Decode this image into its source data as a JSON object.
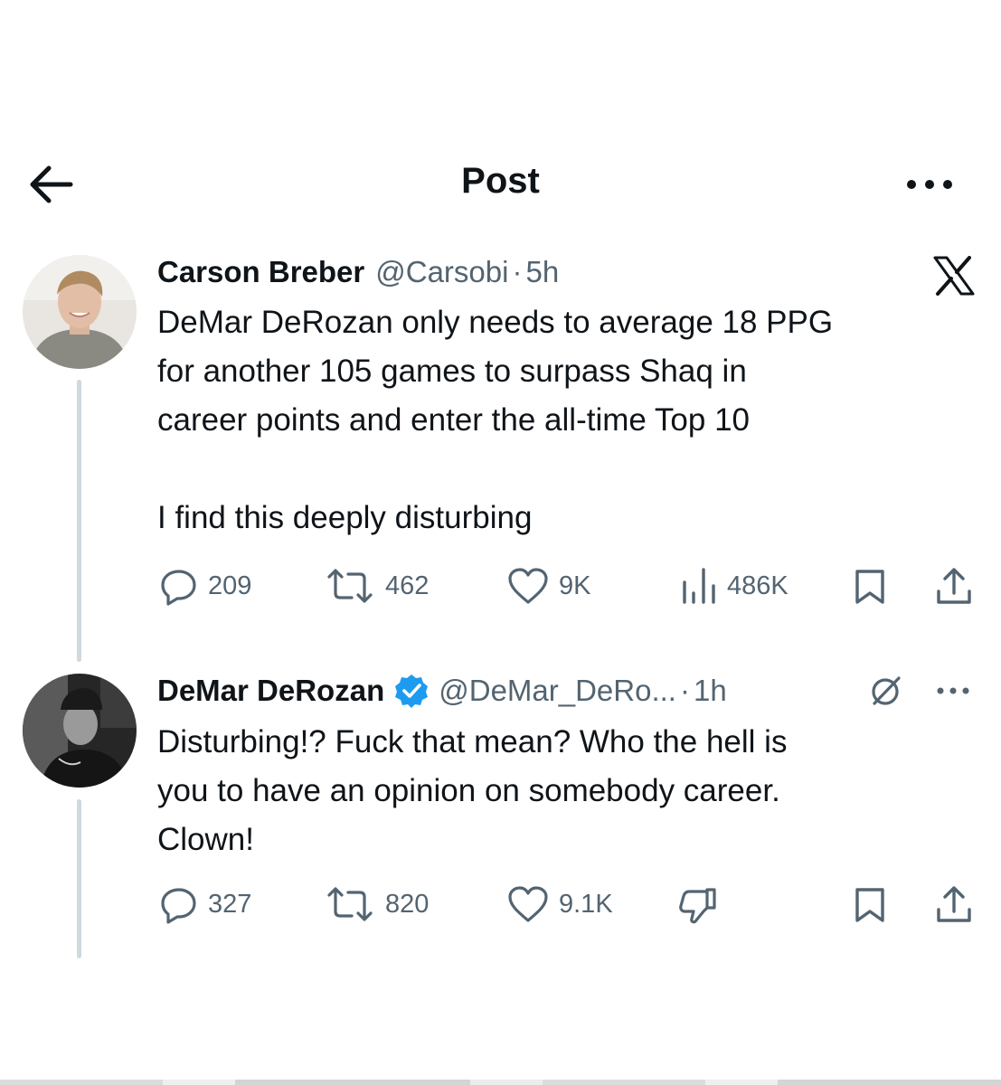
{
  "header": {
    "title": "Post",
    "back_icon": "arrow-left-icon",
    "more_icon": "more-horizontal-icon"
  },
  "post": {
    "author_name": "Carson Breber",
    "author_handle": "@Carsobi",
    "separator": "·",
    "time": "5h",
    "lines": [
      "DeMar DeRozan only needs to average 18 PPG",
      "for another 105 games to surpass Shaq in",
      "career points and enter the all-time Top 10",
      "",
      "I find this deeply disturbing"
    ],
    "actions": {
      "replies": "209",
      "reposts": "462",
      "likes": "9K",
      "views": "486K"
    },
    "brand_icon": "x-logo-icon"
  },
  "reply": {
    "author_name": "DeMar DeRozan",
    "author_handle": "@DeMar_DeRo...",
    "separator": "·",
    "time": "1h",
    "verified": true,
    "lines": [
      "Disturbing!? Fuck that mean? Who the hell is",
      "you to have an opinion on somebody career.",
      "Clown!"
    ],
    "actions": {
      "replies": "327",
      "reposts": "820",
      "likes": "9.1K"
    },
    "colors": {
      "verified": "#1d9bf0"
    }
  }
}
